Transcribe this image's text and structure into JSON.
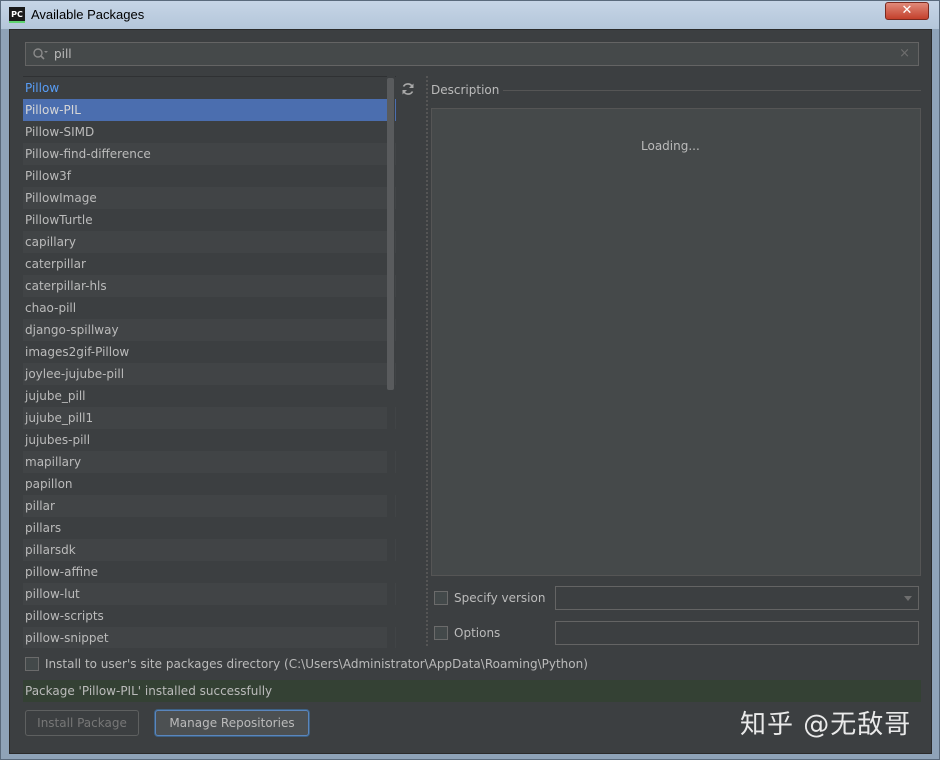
{
  "window": {
    "title": "Available Packages",
    "app_icon_text": "PC",
    "close_glyph": "✕"
  },
  "search": {
    "value": "pill",
    "icon": "search-icon",
    "clear_glyph": "×"
  },
  "packages": {
    "items": [
      {
        "label": "Pillow",
        "state": "link"
      },
      {
        "label": "Pillow-PIL",
        "state": "selected"
      },
      {
        "label": "Pillow-SIMD",
        "state": "normal"
      },
      {
        "label": "Pillow-find-difference",
        "state": "normal"
      },
      {
        "label": "Pillow3f",
        "state": "normal"
      },
      {
        "label": "PillowImage",
        "state": "normal"
      },
      {
        "label": "PillowTurtle",
        "state": "normal"
      },
      {
        "label": "capillary",
        "state": "normal"
      },
      {
        "label": "caterpillar",
        "state": "normal"
      },
      {
        "label": "caterpillar-hls",
        "state": "normal"
      },
      {
        "label": "chao-pill",
        "state": "normal"
      },
      {
        "label": "django-spillway",
        "state": "normal"
      },
      {
        "label": "images2gif-Pillow",
        "state": "normal"
      },
      {
        "label": "joylee-jujube-pill",
        "state": "normal"
      },
      {
        "label": "jujube_pill",
        "state": "normal"
      },
      {
        "label": "jujube_pill1",
        "state": "normal"
      },
      {
        "label": "jujubes-pill",
        "state": "normal"
      },
      {
        "label": "mapillary",
        "state": "normal"
      },
      {
        "label": "papillon",
        "state": "normal"
      },
      {
        "label": "pillar",
        "state": "normal"
      },
      {
        "label": "pillars",
        "state": "normal"
      },
      {
        "label": "pillarsdk",
        "state": "normal"
      },
      {
        "label": "pillow-affine",
        "state": "normal"
      },
      {
        "label": "pillow-lut",
        "state": "normal"
      },
      {
        "label": "pillow-scripts",
        "state": "normal"
      },
      {
        "label": "pillow-snippet",
        "state": "normal"
      }
    ],
    "refresh_icon": "refresh-icon"
  },
  "description": {
    "label": "Description",
    "loading_text": "Loading..."
  },
  "options": {
    "specify_version_label": "Specify version",
    "specify_version_value": "",
    "options_label": "Options",
    "options_value": ""
  },
  "install_user_dir": {
    "label": "Install to user's site packages directory (C:\\Users\\Administrator\\AppData\\Roaming\\Python)"
  },
  "status": {
    "message": "Package 'Pillow-PIL' installed successfully"
  },
  "buttons": {
    "install_label": "Install Package",
    "manage_label": "Manage Repositories"
  },
  "watermark": {
    "text": "知乎 @无敌哥"
  },
  "colors": {
    "selection": "#4b6eaf",
    "link": "#589df6",
    "status_bg": "#344134"
  }
}
